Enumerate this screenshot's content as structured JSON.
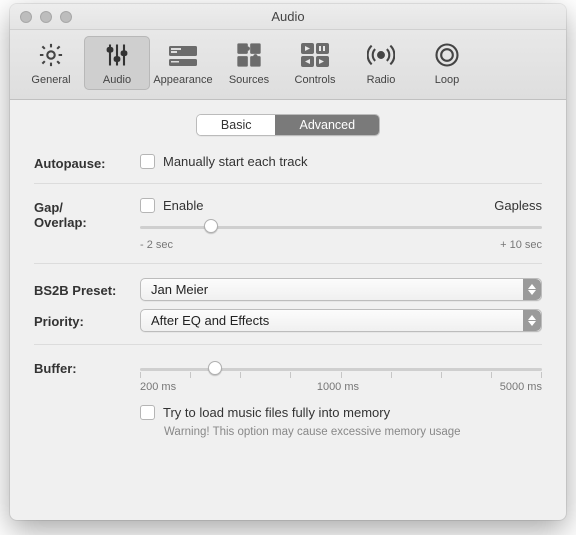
{
  "window": {
    "title": "Audio"
  },
  "toolbar": {
    "items": [
      {
        "label": "General"
      },
      {
        "label": "Audio"
      },
      {
        "label": "Appearance"
      },
      {
        "label": "Sources"
      },
      {
        "label": "Controls"
      },
      {
        "label": "Radio"
      },
      {
        "label": "Loop"
      }
    ]
  },
  "tabs": {
    "basic": "Basic",
    "advanced": "Advanced"
  },
  "autopause": {
    "label": "Autopause:",
    "checkbox": "Manually start each track"
  },
  "gap": {
    "label": "Gap/\nOverlap:",
    "enable": "Enable",
    "gapless": "Gapless",
    "min": "- 2 sec",
    "max": "+ 10 sec"
  },
  "bs2b": {
    "label": "BS2B Preset:",
    "value": "Jan Meier"
  },
  "priority": {
    "label": "Priority:",
    "value": "After EQ and Effects"
  },
  "buffer": {
    "label": "Buffer:",
    "t0": "200 ms",
    "t1": "1000 ms",
    "t2": "5000 ms"
  },
  "memory": {
    "checkbox": "Try to load music files fully into memory",
    "warning": "Warning! This option may cause excessive memory usage"
  }
}
